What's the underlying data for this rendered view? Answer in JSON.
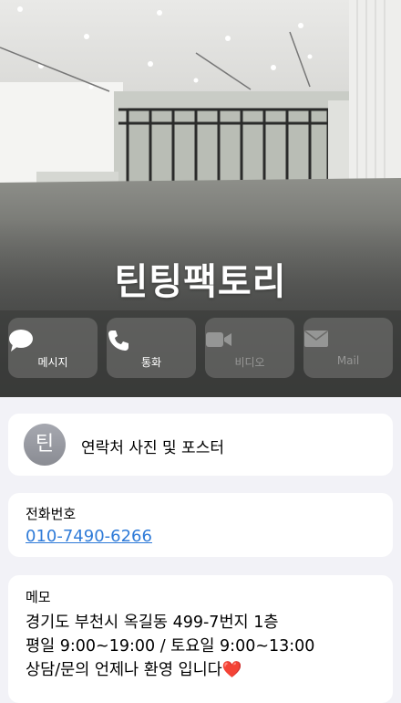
{
  "contact": {
    "name": "틴팅팩토리",
    "avatar_initial": "틴"
  },
  "actions": [
    {
      "label": "메시지",
      "icon": "message-icon",
      "enabled": true
    },
    {
      "label": "통화",
      "icon": "phone-icon",
      "enabled": true
    },
    {
      "label": "비디오",
      "icon": "video-icon",
      "enabled": false
    },
    {
      "label": "Mail",
      "icon": "mail-icon",
      "enabled": false
    }
  ],
  "photo_poster": {
    "label": "연락처 사진 및 포스터"
  },
  "phone": {
    "label": "전화번호",
    "number": "010-7490-6266"
  },
  "memo": {
    "label": "메모",
    "lines": [
      "경기도 부천시 옥길동 499-7번지 1층",
      "평일 9:00~19:00 / 토요일 9:00~13:00",
      "상담/문의 언제나 환영 입니다"
    ],
    "emoji": "❤️"
  },
  "colors": {
    "accent_link": "#2f7bd8",
    "background": "#f2f2f7"
  }
}
